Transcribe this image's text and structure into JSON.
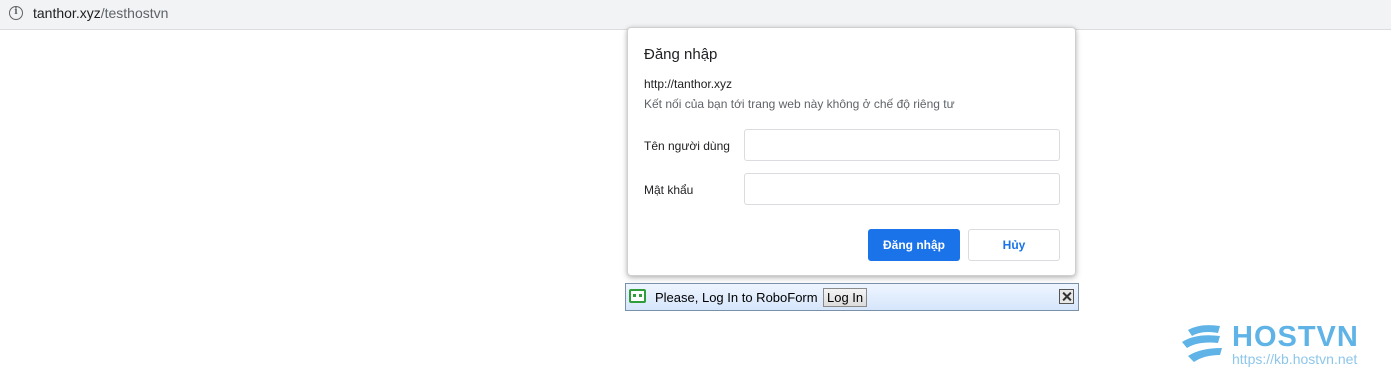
{
  "browser": {
    "url_host": "tanthor.xyz",
    "url_path": "/testhostvn"
  },
  "dialog": {
    "title": "Đăng nhập",
    "origin": "http://tanthor.xyz",
    "warning": "Kết nối của bạn tới trang web này không ở chế độ riêng tư",
    "username_label": "Tên người dùng",
    "username_value": "",
    "password_label": "Mật khẩu",
    "password_value": "",
    "login_button": "Đăng nhập",
    "cancel_button": "Hủy"
  },
  "roboform": {
    "message": "Please, Log In to RoboForm",
    "login_button": "Log In"
  },
  "watermark": {
    "brand": "HOSTVN",
    "url": "https://kb.hostvn.net"
  },
  "colors": {
    "primary_button": "#1a73e8",
    "watermark": "#5fb3e6",
    "roboform_icon": "#2e9e3a"
  },
  "icons": [
    "info-icon",
    "roboform-icon",
    "close-icon",
    "hostvn-logo-icon"
  ]
}
